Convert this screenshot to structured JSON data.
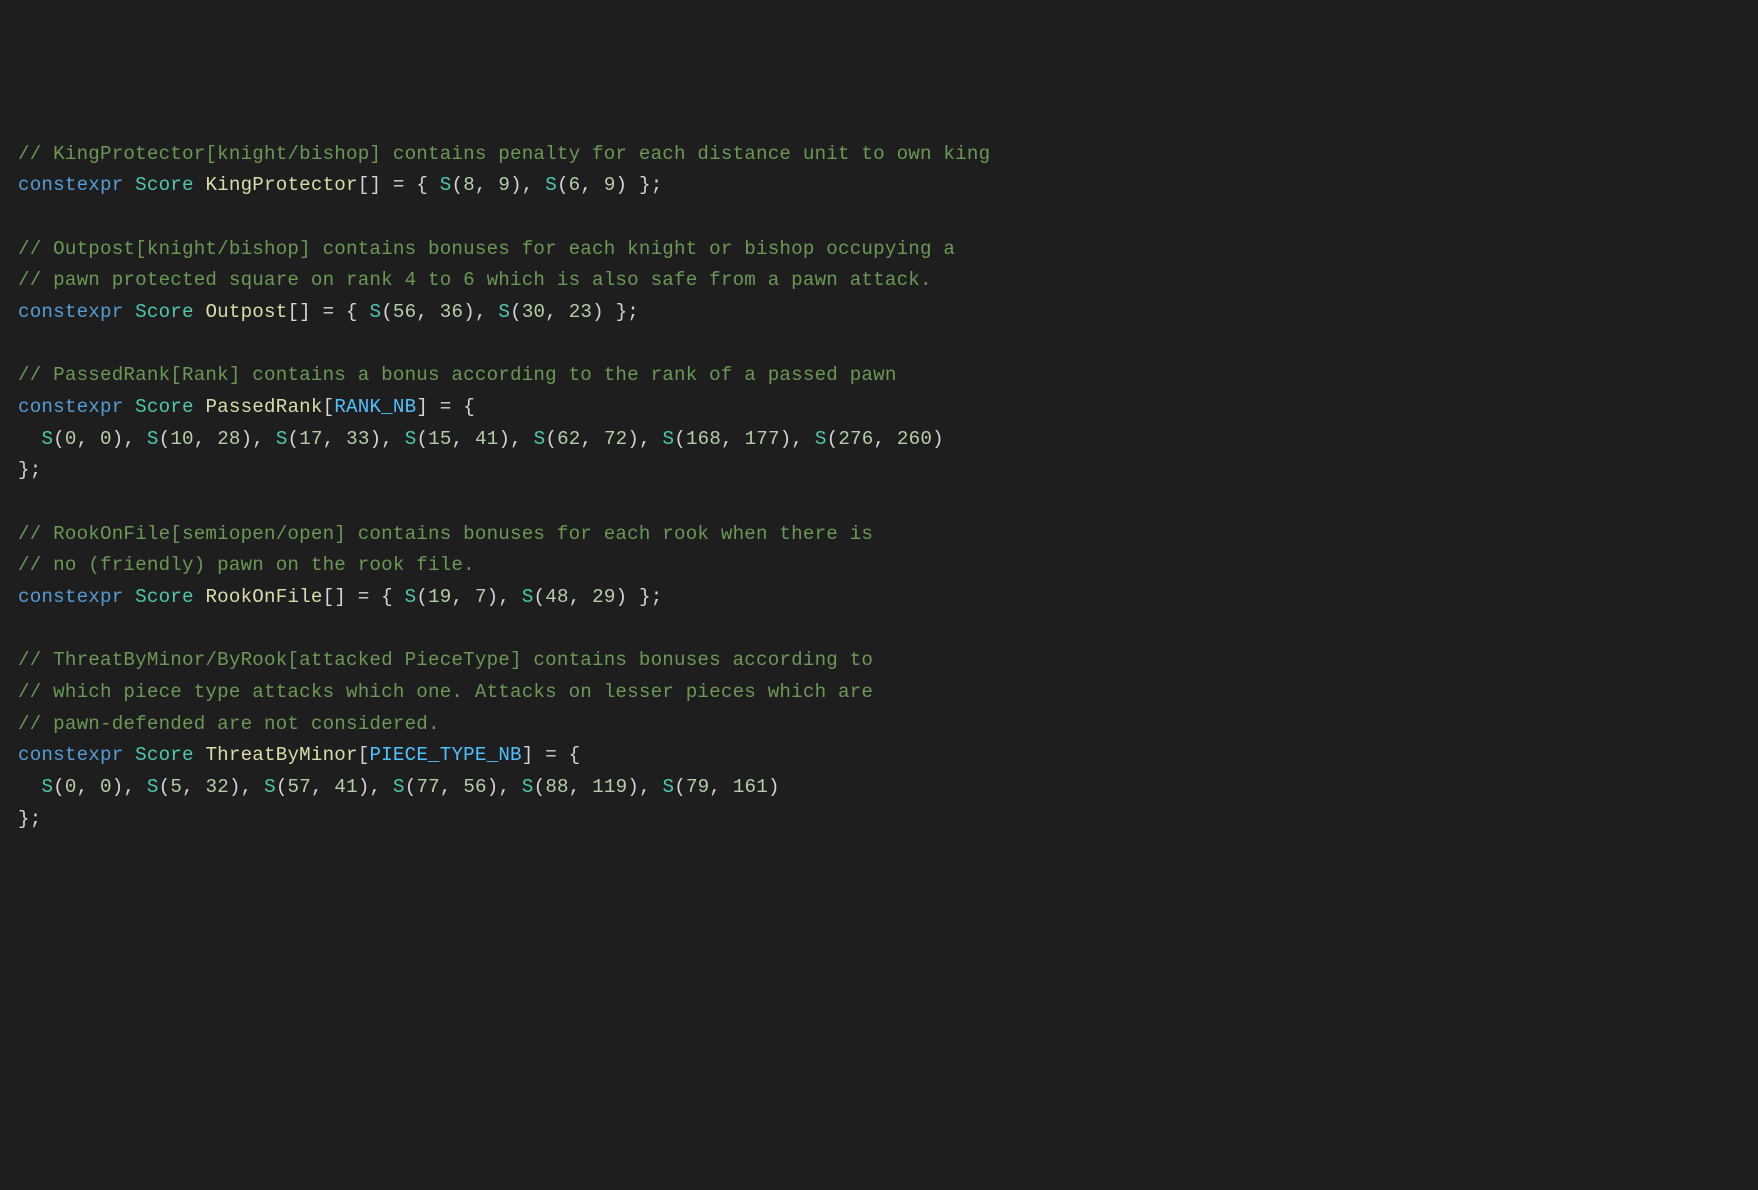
{
  "code": {
    "comments": {
      "kingprotector": "// KingProtector[knight/bishop] contains penalty for each distance unit to own king",
      "outpost1": "// Outpost[knight/bishop] contains bonuses for each knight or bishop occupying a",
      "outpost2": "// pawn protected square on rank 4 to 6 which is also safe from a pawn attack.",
      "passedrank": "// PassedRank[Rank] contains a bonus according to the rank of a passed pawn",
      "rookonfile1": "// RookOnFile[semiopen/open] contains bonuses for each rook when there is",
      "rookonfile2": "// no (friendly) pawn on the rook file.",
      "threat1": "// ThreatByMinor/ByRook[attacked PieceType] contains bonuses according to",
      "threat2": "// which piece type attacks which one. Attacks on lesser pieces which are",
      "threat3": "// pawn-defended are not considered."
    },
    "kw": {
      "constexpr": "constexpr"
    },
    "types": {
      "score": "Score"
    },
    "macros": {
      "S": "S"
    },
    "constants": {
      "rank_nb": "RANK_NB",
      "piece_type_nb": "PIECE_TYPE_NB"
    },
    "decls": {
      "kingprotector": {
        "name": "KingProtector",
        "values": [
          [
            8,
            9
          ],
          [
            6,
            9
          ]
        ]
      },
      "outpost": {
        "name": "Outpost",
        "values": [
          [
            56,
            36
          ],
          [
            30,
            23
          ]
        ]
      },
      "passedrank": {
        "name": "PassedRank",
        "values": [
          [
            0,
            0
          ],
          [
            10,
            28
          ],
          [
            17,
            33
          ],
          [
            15,
            41
          ],
          [
            62,
            72
          ],
          [
            168,
            177
          ],
          [
            276,
            260
          ]
        ]
      },
      "rookonfile": {
        "name": "RookOnFile",
        "values": [
          [
            19,
            7
          ],
          [
            48,
            29
          ]
        ]
      },
      "threatbyminor": {
        "name": "ThreatByMinor",
        "values": [
          [
            0,
            0
          ],
          [
            5,
            32
          ],
          [
            57,
            41
          ],
          [
            77,
            56
          ],
          [
            88,
            119
          ],
          [
            79,
            161
          ]
        ]
      }
    }
  }
}
